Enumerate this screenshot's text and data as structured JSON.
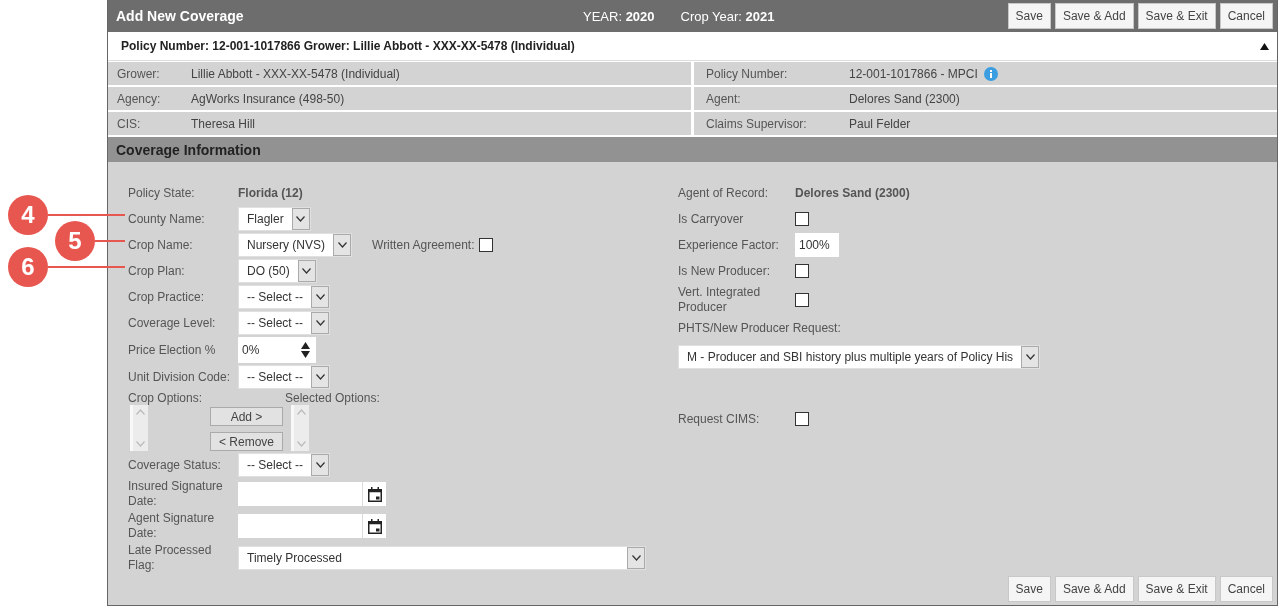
{
  "header": {
    "title": "Add New Coverage",
    "year_label": "YEAR:",
    "year": "2020",
    "crop_year_label": "Crop Year:",
    "crop_year": "2021",
    "buttons": [
      "Save",
      "Save & Add",
      "Save & Exit",
      "Cancel"
    ]
  },
  "policy_bar": {
    "text": "Policy Number: 12-001-1017866 Grower: Lillie Abbott - XXX-XX-5478 (Individual)",
    "expanded": true
  },
  "info_rows": [
    {
      "left": {
        "label": "Grower:",
        "value": "Lillie Abbott - XXX-XX-5478 (Individual)"
      },
      "right": {
        "label": "Policy Number:",
        "value": "12-001-1017866 - MPCI",
        "info_icon": true
      }
    },
    {
      "left": {
        "label": "Agency:",
        "value": "AgWorks Insurance (498-50)"
      },
      "right": {
        "label": "Agent:",
        "value": "Delores Sand (2300)",
        "info_icon": false
      }
    },
    {
      "left": {
        "label": "CIS:",
        "value": "Theresa Hill"
      },
      "right": {
        "label": "Claims Supervisor:",
        "value": "Paul Felder",
        "info_icon": false
      }
    }
  ],
  "section_title": "Coverage Information",
  "left_fields": [
    {
      "kind": "static",
      "label": "Policy State:",
      "value": "Florida (12)"
    },
    {
      "kind": "select",
      "label": "County Name:",
      "value": "Flagler"
    },
    {
      "kind": "select",
      "label": "Crop Name:",
      "value": "Nursery (NVS)",
      "extra": {
        "label": "Written Agreement:",
        "checked": false
      }
    },
    {
      "kind": "select",
      "label": "Crop Plan:",
      "value": "DO (50)"
    },
    {
      "kind": "select",
      "label": "Crop Practice:",
      "value": "-- Select --"
    },
    {
      "kind": "select",
      "label": "Coverage Level:",
      "value": "-- Select --"
    },
    {
      "kind": "spinner",
      "label": "Price Election %",
      "value": "0%"
    },
    {
      "kind": "select",
      "label": "Unit Division Code:",
      "value": "-- Select --"
    },
    {
      "kind": "dual_list",
      "label": "Crop Options:",
      "selected_label": "Selected Options:",
      "buttons": [
        "Add >",
        "< Remove"
      ]
    },
    {
      "kind": "select",
      "label": "Coverage Status:",
      "value": "-- Select --"
    },
    {
      "kind": "date",
      "label": "Insured Signature Date:"
    },
    {
      "kind": "date",
      "label": "Agent Signature Date:"
    },
    {
      "kind": "wide_select",
      "label": "Late Processed Flag:",
      "value": "Timely Processed"
    }
  ],
  "right_fields": [
    {
      "kind": "static",
      "label": "Agent of Record:",
      "value": "Delores Sand (2300)"
    },
    {
      "kind": "checkbox",
      "label": "Is Carryover",
      "checked": false
    },
    {
      "kind": "text",
      "label": "Experience Factor:",
      "value": "100%"
    },
    {
      "kind": "checkbox",
      "label": "Is New Producer:",
      "checked": false
    },
    {
      "kind": "checkbox",
      "label": "Vert. Integrated Producer",
      "checked": false
    },
    {
      "kind": "block_select",
      "label": "PHTS/New Producer Request:",
      "value": "M - Producer and SBI history plus multiple years of Policy His"
    },
    {
      "kind": "checkbox",
      "label": "Request CIMS:",
      "checked": false
    }
  ],
  "footer_buttons": [
    "Save",
    "Save & Add",
    "Save & Exit",
    "Cancel"
  ],
  "callouts": [
    {
      "number": "4"
    },
    {
      "number": "5"
    },
    {
      "number": "6"
    }
  ]
}
